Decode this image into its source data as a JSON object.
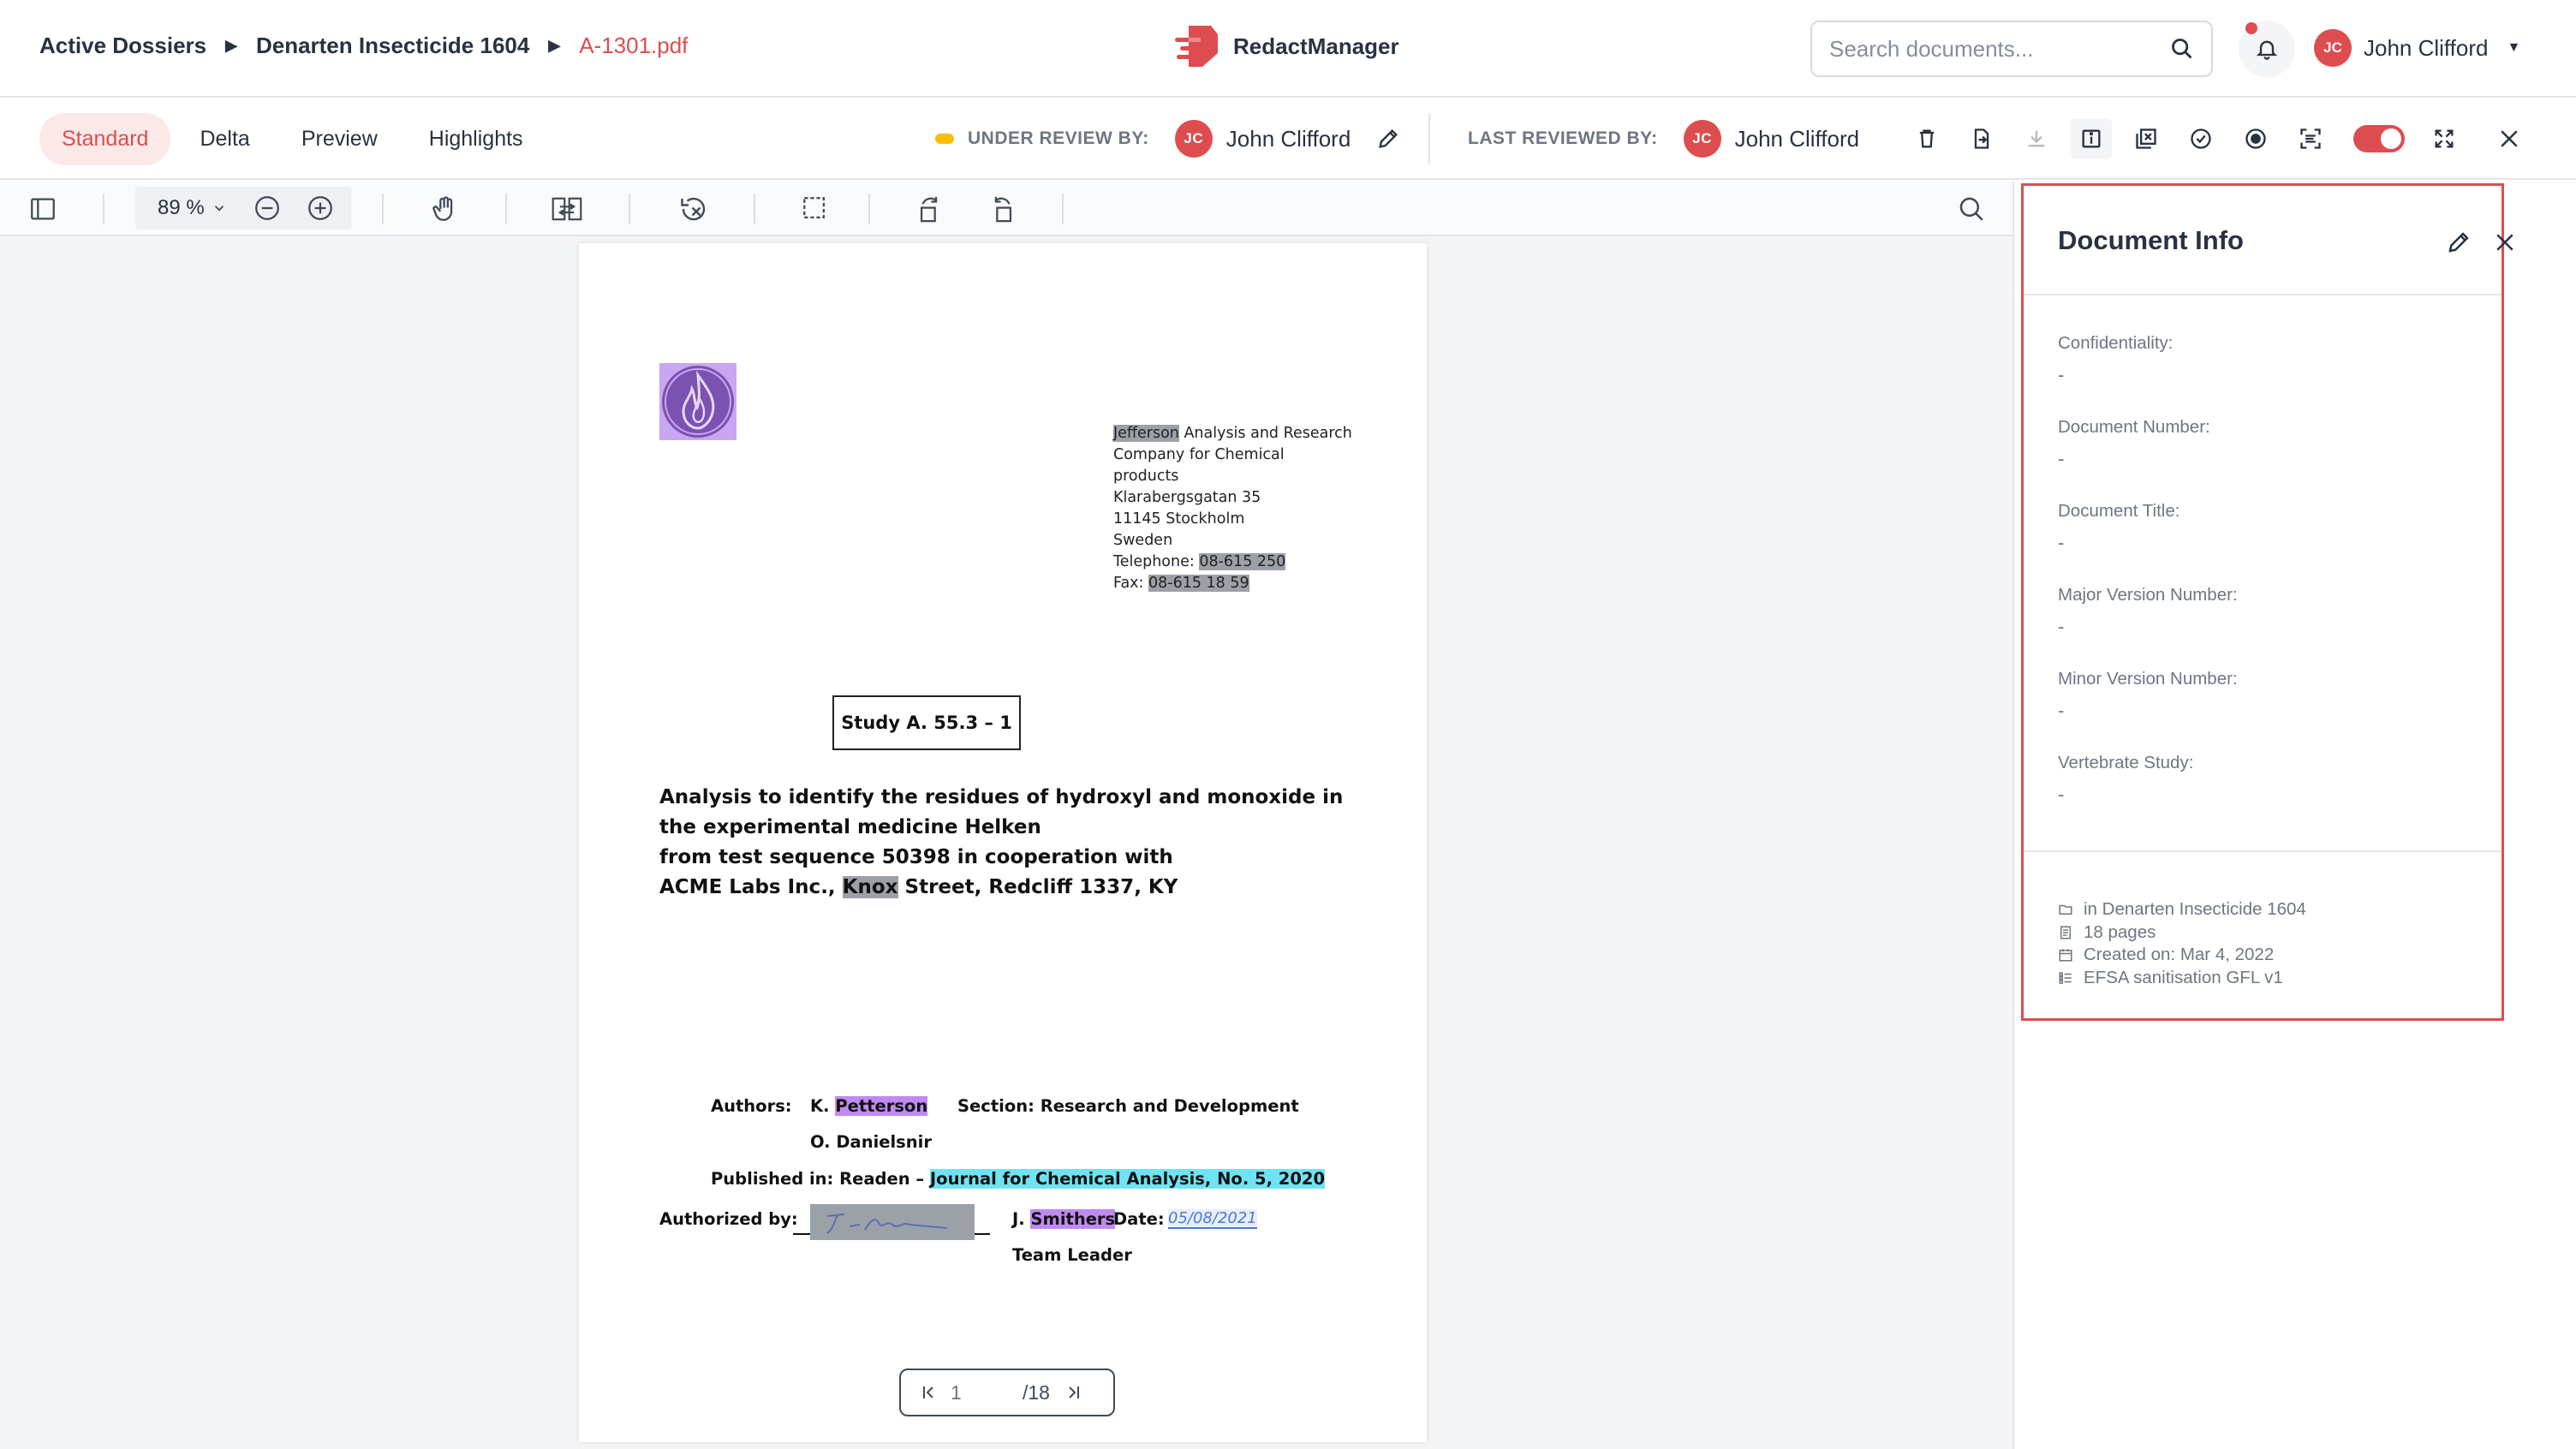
{
  "breadcrumb": {
    "item1": "Active Dossiers",
    "item2": "Denarten Insecticide 1604",
    "current": "A-1301.pdf"
  },
  "app": {
    "name": "RedactManager",
    "accent_color": "#dd4d50"
  },
  "search": {
    "placeholder": "Search documents..."
  },
  "user": {
    "initials": "JC",
    "name": "John Clifford"
  },
  "tabs": [
    "Standard",
    "Delta",
    "Preview",
    "Highlights"
  ],
  "review": {
    "under_review_label": "UNDER REVIEW BY:",
    "under_review_initials": "JC",
    "under_review_name": "John Clifford",
    "last_reviewed_label": "LAST REVIEWED BY:",
    "last_reviewed_initials": "JC",
    "last_reviewed_name": "John Clifford"
  },
  "viewer": {
    "zoom": "89 %",
    "page_current": "1",
    "page_total": "/18"
  },
  "document": {
    "address": [
      "Jefferson",
      " Analysis and Research",
      "Company for Chemical",
      "products",
      "Klarabergsgatan 35",
      "11145 Stockholm",
      "Sweden",
      "Telephone: ",
      "08-615 250",
      "Fax: ",
      "08-615 18 59"
    ],
    "study": "Study A. 55.3 – 1",
    "title_lines": [
      "Analysis to identify the residues of hydroxyl and monoxide in",
      "the experimental medicine Helken",
      "from test sequence 50398 in cooperation with",
      "ACME Labs Inc., ",
      "Knox",
      " Street, Redcliff 1337, KY"
    ],
    "authors_label": "Authors:",
    "author1_prefix": "K. ",
    "author1_name": "Petterson",
    "section": "Section: Research and Development",
    "author2": "O. Danielsnir",
    "published_label": "Published in: Readen – ",
    "published_journal": "Journal for Chemical Analysis, No. 5, 2020",
    "authorized_label": "Authorized by:",
    "signer_prefix": "J. ",
    "signer_name": "Smithers",
    "date_label": "Date:",
    "date_value": "05/08/2021",
    "role": "Team Leader"
  },
  "doc_info": {
    "title": "Document Info",
    "fields": [
      {
        "label": "Confidentiality:",
        "value": "-"
      },
      {
        "label": "Document Number:",
        "value": "-"
      },
      {
        "label": "Document Title:",
        "value": "-"
      },
      {
        "label": "Major Version Number:",
        "value": "-"
      },
      {
        "label": "Minor Version Number:",
        "value": "-"
      },
      {
        "label": "Vertebrate Study:",
        "value": "-"
      }
    ],
    "meta": {
      "dossier": "in Denarten Insecticide 1604",
      "pages": "18 pages",
      "created": "Created on: Mar 4, 2022",
      "template": "EFSA sanitisation GFL v1"
    }
  }
}
